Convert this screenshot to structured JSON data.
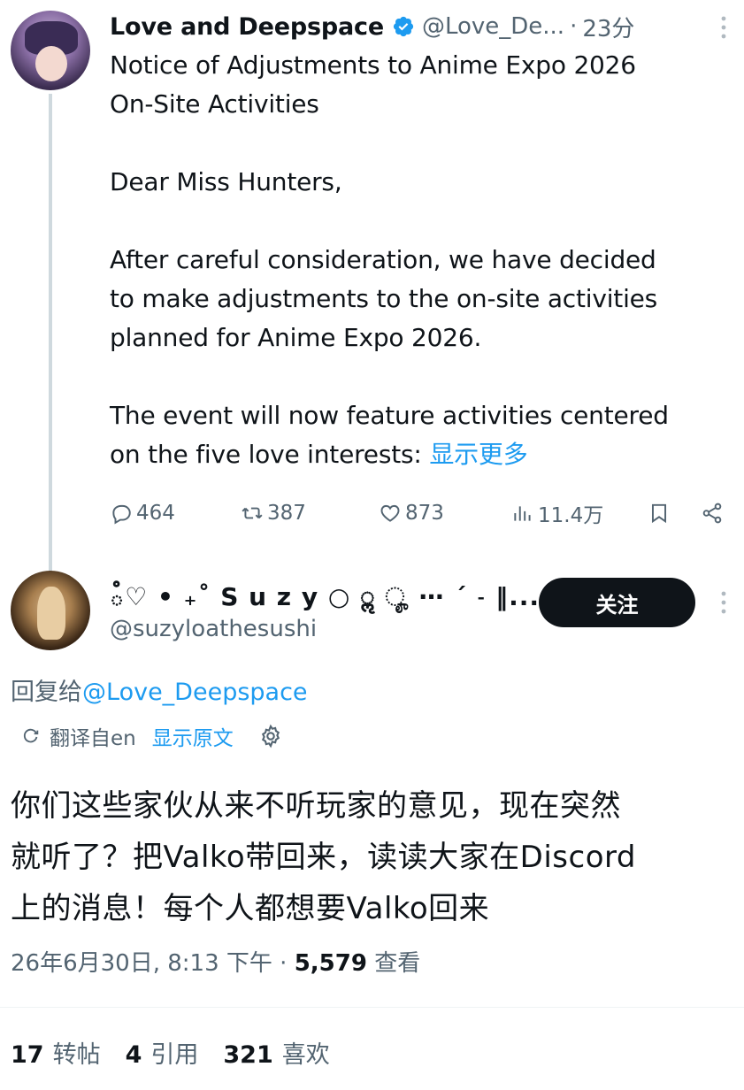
{
  "tweet": {
    "author_name": "Love and Deepspace",
    "handle": "@Love_De...",
    "separator": "·",
    "time": "23分",
    "body": [
      "Notice of Adjustments to Anime Expo 2026",
      "On-Site Activities",
      "",
      "Dear Miss Hunters,",
      "",
      "After careful consideration, we have decided",
      "to make adjustments to the on-site activities",
      "planned for Anime Expo 2026.",
      "",
      "The event will now feature activities centered",
      "on the five love interests:"
    ],
    "show_more": "显示更多",
    "actions": {
      "replies": "464",
      "retweets": "387",
      "likes": "873",
      "views": "11.4万"
    }
  },
  "reply": {
    "display_name": "ఄ♡ • ₊˚ S u z y ○ ॢ ೄ ⋯ ˊ ˗ ‖...",
    "handle": "@suzyloathesushi",
    "follow_label": "关注",
    "reply_to_prefix": "回复给",
    "reply_to_handle": "@Love_Deepspace",
    "translated_from": "翻译自en",
    "show_original": "显示原文",
    "body_lines": [
      "你们这些家伙从来不听玩家的意见，现在突然",
      "就听了？把Valko带回来，读读大家在Discord",
      "上的消息！每个人都想要Valko回来"
    ],
    "timestamp": "26年6月30日, 8:13 下午",
    "separator": "·",
    "view_count": "5,579",
    "view_label": "查看",
    "stats": {
      "retweets": "17",
      "retweets_label": "转帖",
      "quotes": "4",
      "quotes_label": "引用",
      "likes": "321",
      "likes_label": "喜欢"
    }
  },
  "colors": {
    "accent": "#1d9bf0",
    "muted": "#536471",
    "text": "#0f1419",
    "button_bg": "#0f1419"
  }
}
